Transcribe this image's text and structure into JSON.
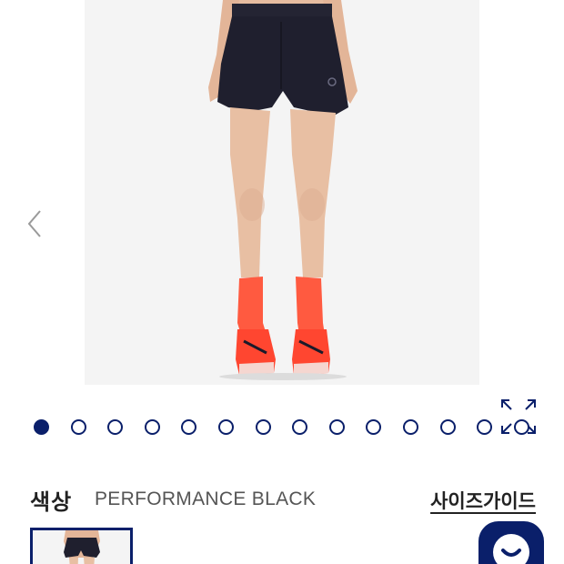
{
  "gallery": {
    "image_icon": "model-wearing-shorts-image",
    "prev_icon": "chevron-left-icon",
    "expand_icon": "expand-arrows-icon",
    "dot_count": 14,
    "active_dot": 0
  },
  "color": {
    "label": "색상",
    "value": "PERFORMANCE BLACK"
  },
  "size_guide": {
    "label": "사이즈가이드"
  },
  "chat": {
    "icon": "chat-bubble-icon"
  },
  "colors": {
    "accent": "#0a1f6a",
    "socks": "#ff4b3a",
    "shorts": "#1d1d2b",
    "skin": "#e8bfa3",
    "photo_bg": "#f4f4f4"
  }
}
